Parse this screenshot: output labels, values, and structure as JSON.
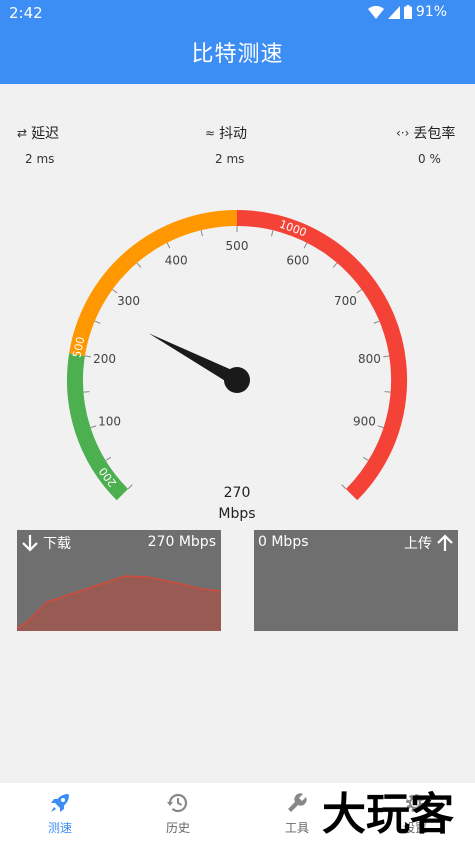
{
  "status_bar": {
    "time": "2:42",
    "battery": "91%"
  },
  "app_bar": {
    "title": "比特测速"
  },
  "metrics": {
    "latency": {
      "label": "延迟",
      "value": "2 ms"
    },
    "jitter": {
      "label": "抖动",
      "value": "2 ms"
    },
    "packet_loss": {
      "label": "丢包率",
      "value": "0 %"
    }
  },
  "gauge": {
    "ticks_inner": [
      "100",
      "200",
      "300",
      "400",
      "500",
      "600",
      "700",
      "800",
      "900"
    ],
    "ticks_outer": [
      "200",
      "500",
      "1000"
    ],
    "needle_value_mbps": 270,
    "colors": {
      "green": "#4caf50",
      "orange": "#ff9800",
      "red": "#f44336",
      "needle": "#1a1a1a"
    }
  },
  "readout": {
    "value": "270",
    "unit": "Mbps"
  },
  "download": {
    "label": "下载",
    "value": "270 Mbps"
  },
  "upload": {
    "label": "上传",
    "value": "0 Mbps"
  },
  "nav": {
    "speedtest": "测速",
    "history": "历史",
    "tools": "工具",
    "settings": "设置"
  },
  "watermark": {
    "text": "大玩客"
  },
  "colors": {
    "primary": "#3d8ef4",
    "panel": "#6f6f6f",
    "sparkline": "#d14b3d"
  }
}
